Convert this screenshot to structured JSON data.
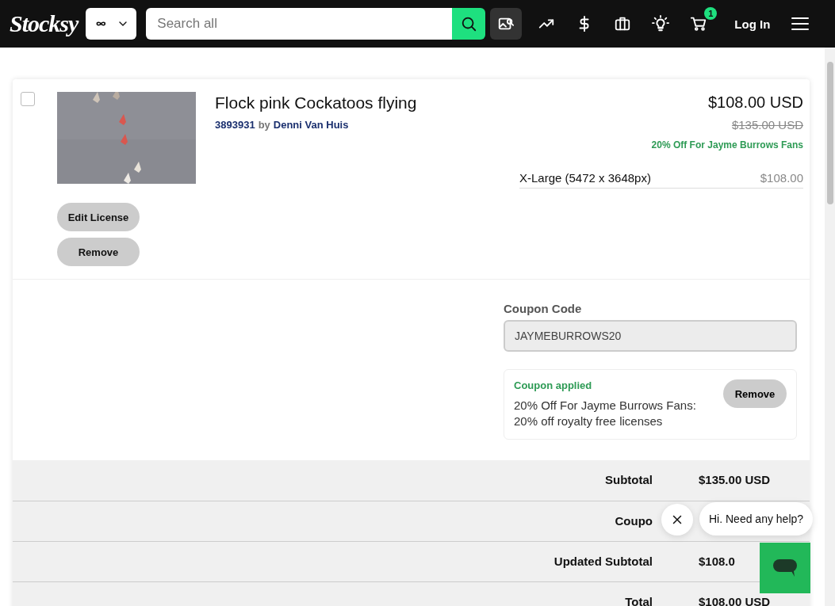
{
  "header": {
    "logo": "Stocksy",
    "search": {
      "placeholder": "Search all"
    },
    "cart_badge": "1",
    "login": "Log In"
  },
  "cart_item": {
    "checked": false,
    "title": "Flock pink Cockatoos flying",
    "id": "3893931",
    "by": "by",
    "author": "Denni Van Huis",
    "buttons": [
      "Edit License",
      "Remove"
    ],
    "price": "$108.00 USD",
    "original_price": "$135.00 USD",
    "discount": "20% Off For Jayme Burrows Fans",
    "license": {
      "size": "X-Large (5472 x 3648px)",
      "price": "$108.00"
    }
  },
  "coupon": {
    "label": "Coupon Code",
    "value": "JAYMEBURROWS20",
    "status": "Coupon applied",
    "description": "20% Off For Jayme Burrows Fans: 20% off royalty free licenses",
    "remove": "Remove"
  },
  "summary": [
    {
      "label": "Subtotal",
      "value": "$135.00 USD"
    },
    {
      "label": "Coupo"
    },
    {
      "label": "Updated Subtotal",
      "value": "$108.0"
    },
    {
      "label": "Total",
      "value": "$108.00 USD"
    }
  ],
  "chat": {
    "message": "Hi. Need any help?"
  }
}
